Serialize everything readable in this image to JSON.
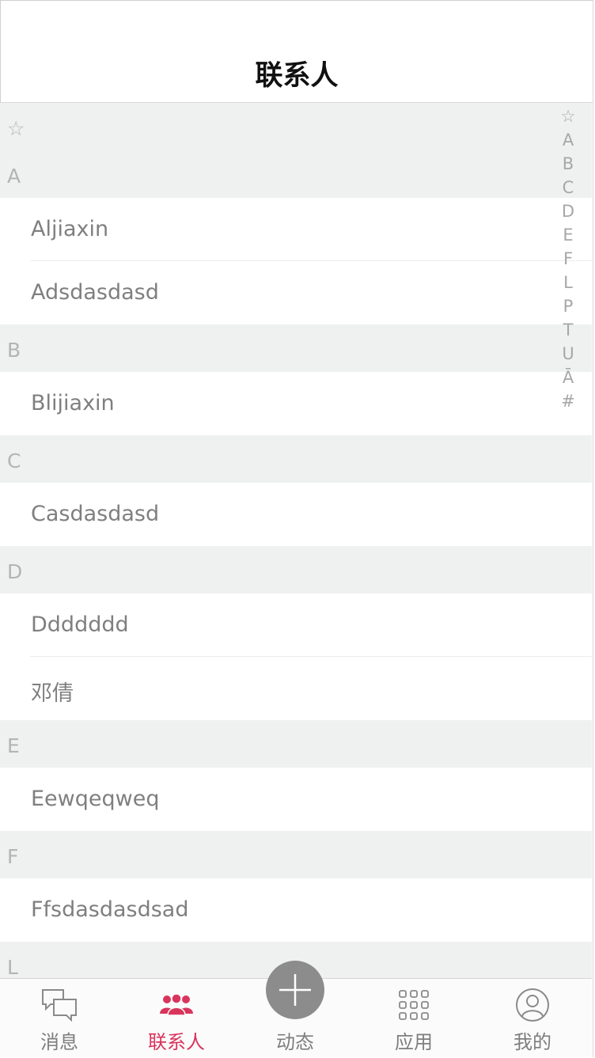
{
  "header": {
    "title": "联系人"
  },
  "sections": [
    {
      "letter": "☆",
      "contacts": []
    },
    {
      "letter": "A",
      "contacts": [
        "Aljiaxin",
        "Adsdasdasd"
      ]
    },
    {
      "letter": "B",
      "contacts": [
        "Blijiaxin"
      ]
    },
    {
      "letter": "C",
      "contacts": [
        "Casdasdasd"
      ]
    },
    {
      "letter": "D",
      "contacts": [
        "Ddddddd",
        "邓倩"
      ]
    },
    {
      "letter": "E",
      "contacts": [
        "Eewqeqweq"
      ]
    },
    {
      "letter": "F",
      "contacts": [
        "Ffsdasdasdsad"
      ]
    },
    {
      "letter": "L",
      "contacts": []
    }
  ],
  "index_bar": [
    "☆",
    "A",
    "B",
    "C",
    "D",
    "E",
    "F",
    "L",
    "P",
    "T",
    "U",
    "Ā",
    "#"
  ],
  "tabbar": {
    "messages": "消息",
    "contacts": "联系人",
    "moments": "动态",
    "apps": "应用",
    "me": "我的"
  },
  "colors": {
    "accent": "#d9345c",
    "section_bg": "#eff1f0",
    "text_gray": "#7f7f7f",
    "plus_bg": "#8c8c8c"
  }
}
